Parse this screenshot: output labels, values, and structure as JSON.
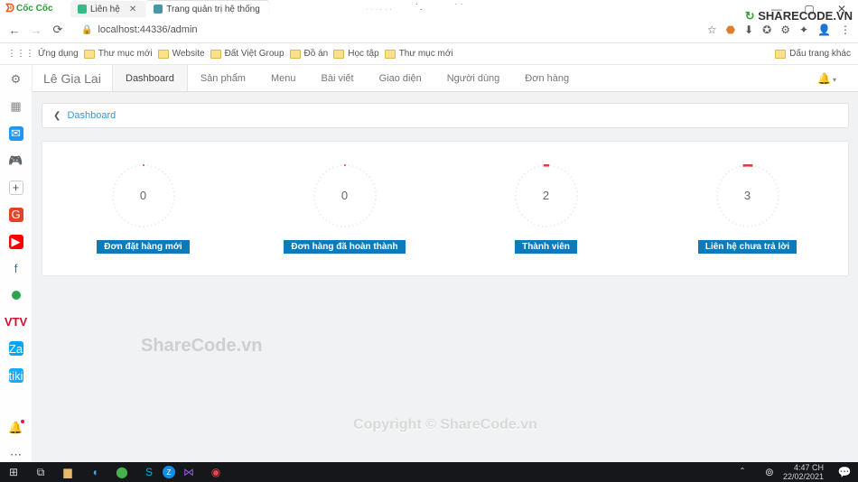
{
  "os": {
    "browser_name": "Cốc Cốc",
    "tabs": [
      {
        "title": "Liên hệ",
        "active": false
      },
      {
        "title": "Trang quản trị hệ thống",
        "active": true
      }
    ],
    "window_buttons": [
      "—",
      "▢",
      "✕"
    ]
  },
  "watermark": {
    "bandicam": "www.BANDICAM.com",
    "sharecode": "SHARECODE",
    "sharecode_tld": ".VN",
    "body1": "ShareCode.vn",
    "body2": "Copyright © ShareCode.vn"
  },
  "nav": {
    "url": "localhost:44336/admin"
  },
  "bookmarks": {
    "apps": "Ứng dụng",
    "items": [
      "Thư mục mới",
      "Website",
      "Đất Việt Group",
      "Đồ án",
      "Học tập",
      "Thư mục mới"
    ],
    "right": "Dấu trang khác"
  },
  "admin": {
    "brand": "Lê Gia Lai",
    "tabs": [
      "Dashboard",
      "Sản phẩm",
      "Menu",
      "Bài viết",
      "Giao diện",
      "Người dùng",
      "Đơn hàng"
    ],
    "active_tab": "Dashboard",
    "breadcrumb": "Dashboard",
    "gauges": [
      {
        "value": "0",
        "label": "Đơn đặt hàng mới",
        "fill": 0
      },
      {
        "value": "0",
        "label": "Đơn hàng đã hoàn thành",
        "fill": 0
      },
      {
        "value": "2",
        "label": "Thành viên",
        "fill": 0.03
      },
      {
        "value": "3",
        "label": "Liên hệ chưa trả lời",
        "fill": 0.05
      }
    ]
  },
  "tray": {
    "time": "4:47 CH",
    "date": "22/02/2021"
  }
}
